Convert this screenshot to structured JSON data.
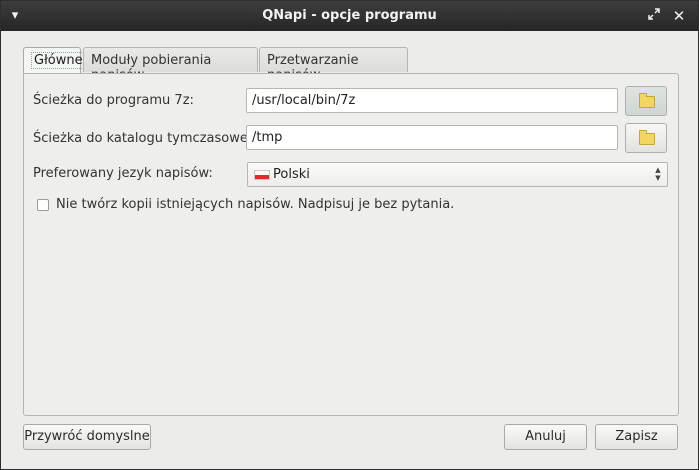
{
  "window": {
    "title": "QNapi - opcje programu"
  },
  "tabs": [
    {
      "label": "Główne"
    },
    {
      "label": "Moduły pobierania napisów"
    },
    {
      "label": "Przetwarzanie napisów"
    }
  ],
  "general": {
    "path_7z_label": "Ścieżka do programu 7z:",
    "path_7z_value": "/usr/local/bin/7z",
    "temp_dir_label": "Ścieżka do katalogu tymczasowego:",
    "temp_dir_value": "/tmp",
    "language_label": "Preferowany jezyk napisów:",
    "language_value": "Polski",
    "no_backup_label": "Nie twórz kopii istniejących napisów. Nadpisuj je bez pytania."
  },
  "buttons": {
    "restore_defaults": "Przywróć domyslne",
    "cancel": "Anuluj",
    "save": "Zapisz"
  },
  "icons": {
    "menu": "chevron-down-icon",
    "maximize": "maximize-icon",
    "close": "close-icon",
    "browse": "folder-icon"
  },
  "colors": {
    "titlebar": "#2e2e2e",
    "background": "#ececea",
    "flag_red": "#dc2c2c"
  }
}
